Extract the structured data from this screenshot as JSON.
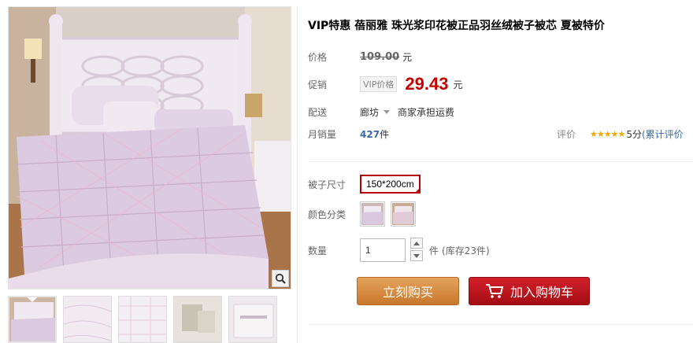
{
  "product": {
    "title": "VIP特惠 蓓丽雅 珠光浆印花被正品羽丝绒被子被芯 夏被特价"
  },
  "price": {
    "label": "价格",
    "original": "109.00",
    "unit": "元"
  },
  "promotion": {
    "label": "促销",
    "tag": "VIP价格",
    "price": "29.43",
    "unit": "元"
  },
  "shipping": {
    "label": "配送",
    "location": "廊坊",
    "note": "商家承担运费"
  },
  "sales": {
    "label": "月销量",
    "count": "427",
    "unit": "件"
  },
  "rating": {
    "label": "评价",
    "stars": "★★★★★",
    "score": "5分",
    "link": "(累计评价"
  },
  "options": {
    "size_label": "被子尺寸",
    "size_value": "150*200cm",
    "color_label": "颜色分类"
  },
  "quantity": {
    "label": "数量",
    "value": "1",
    "unit": "件",
    "stock": "(库存23件)"
  },
  "buttons": {
    "buy_now": "立刻购买",
    "add_to_cart": "加入购物车"
  },
  "colors": {
    "promo_price": "#c40000",
    "buy_button": "#d88a3e",
    "cart_button": "#b5121b",
    "selected_border": "#b5000a"
  },
  "icons": {
    "zoom": "magnifier-icon",
    "cart": "shopping-cart-icon",
    "dropdown": "caret-down-icon",
    "stars": "star-icon"
  }
}
